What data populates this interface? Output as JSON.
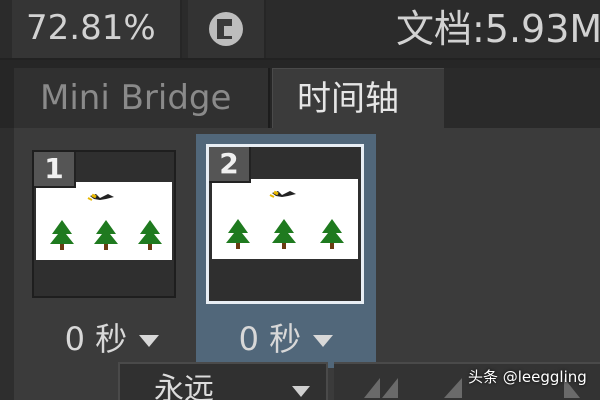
{
  "status_bar": {
    "zoom": "72.81%",
    "doc_info": "文档:5.93M"
  },
  "tabs": [
    {
      "label": "Mini Bridge",
      "active": false
    },
    {
      "label": "时间轴",
      "active": true
    }
  ],
  "frames": [
    {
      "number": "1",
      "delay": "0 秒",
      "selected": false
    },
    {
      "number": "2",
      "delay": "0 秒",
      "selected": true
    }
  ],
  "loop": {
    "value": "永远"
  },
  "watermark": "头条 @leeggling",
  "colors": {
    "selected_frame_bg": "#51677a",
    "tree_green": "#1f7a1f"
  }
}
